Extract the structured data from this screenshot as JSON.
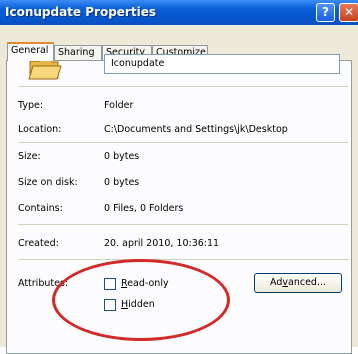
{
  "window": {
    "title": "Iconupdate Properties",
    "help_label": "?",
    "close_label": "✕"
  },
  "tabs": [
    "General",
    "Sharing",
    "Security",
    "Customize"
  ],
  "name_field": {
    "value": "Iconupdate"
  },
  "properties": {
    "type_label": "Type:",
    "type_value": "Folder",
    "location_label": "Location:",
    "location_value": "C:\\Documents and Settings\\jk\\Desktop",
    "size_label": "Size:",
    "size_value": "0 bytes",
    "size_on_disk_label": "Size on disk:",
    "size_on_disk_value": "0 bytes",
    "contains_label": "Contains:",
    "contains_value": "0 Files, 0 Folders",
    "created_label": "Created:",
    "created_value": "20. april 2010, 10:36:11"
  },
  "attributes": {
    "label": "Attributes:",
    "readonly_first": "R",
    "readonly_rest": "ead-only",
    "hidden_first": "H",
    "hidden_rest": "idden",
    "advanced_first": "Ad",
    "advanced_u": "v",
    "advanced_rest": "anced..."
  },
  "icons": {
    "folder": "folder-icon",
    "help": "help-icon",
    "close": "close-icon"
  },
  "colors": {
    "titlebar": "#0a5fd8",
    "highlight_ellipse": "#d12a2a",
    "dialog_bg": "#ece9d8"
  }
}
